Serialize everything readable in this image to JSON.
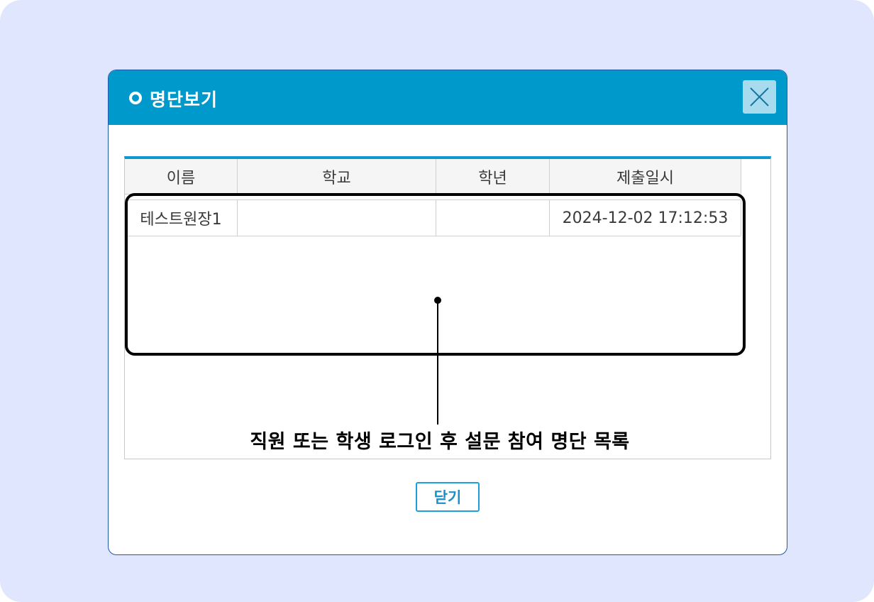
{
  "dialog": {
    "title": "명단보기",
    "close_icon": "close-icon",
    "close_button_label": "닫기"
  },
  "table": {
    "columns": [
      "이름",
      "학교",
      "학년",
      "제출일시"
    ],
    "rows": [
      {
        "name": "테스트원장1",
        "school": "",
        "grade": "",
        "submitted_at": "2024-12-02 17:12:53"
      }
    ]
  },
  "annotation": {
    "text": "직원 또는 학생 로그인 후 설문 참여 명단 목록"
  },
  "colors": {
    "titlebar": "#0099cc",
    "accent_border": "#0a98cf",
    "background": "#dfe6fd"
  }
}
